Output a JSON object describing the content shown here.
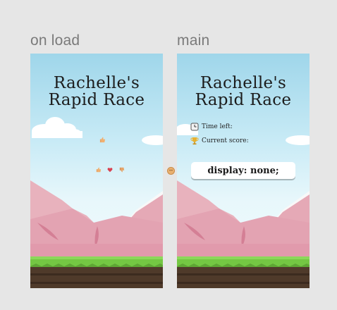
{
  "frames": {
    "onload": {
      "label": "on load"
    },
    "main": {
      "label": "main"
    }
  },
  "game": {
    "title_line1": "Rachelle's",
    "title_line2": "Rapid Race"
  },
  "hud": {
    "time_label": "Time left:",
    "score_label": "Current score:",
    "time_icon": "clock-icon",
    "score_icon": "trophy-icon"
  },
  "overlay": {
    "text": "display: none;"
  },
  "icons": {
    "onload_center_icon": "thumbs-up-icon",
    "onload_left_icon": "thumbs-up-icon",
    "onload_heart_icon": "heart-icon",
    "onload_right_icon": "thumbs-down-icon",
    "connector_icon": "face-icon"
  },
  "colors": {
    "background": "#e6e6e6",
    "sky_top": "#9fd6ea",
    "mountain": "#e8b2bd",
    "grass": "#74c743",
    "soil": "#4f3a2a",
    "heart": "#d9404f"
  }
}
